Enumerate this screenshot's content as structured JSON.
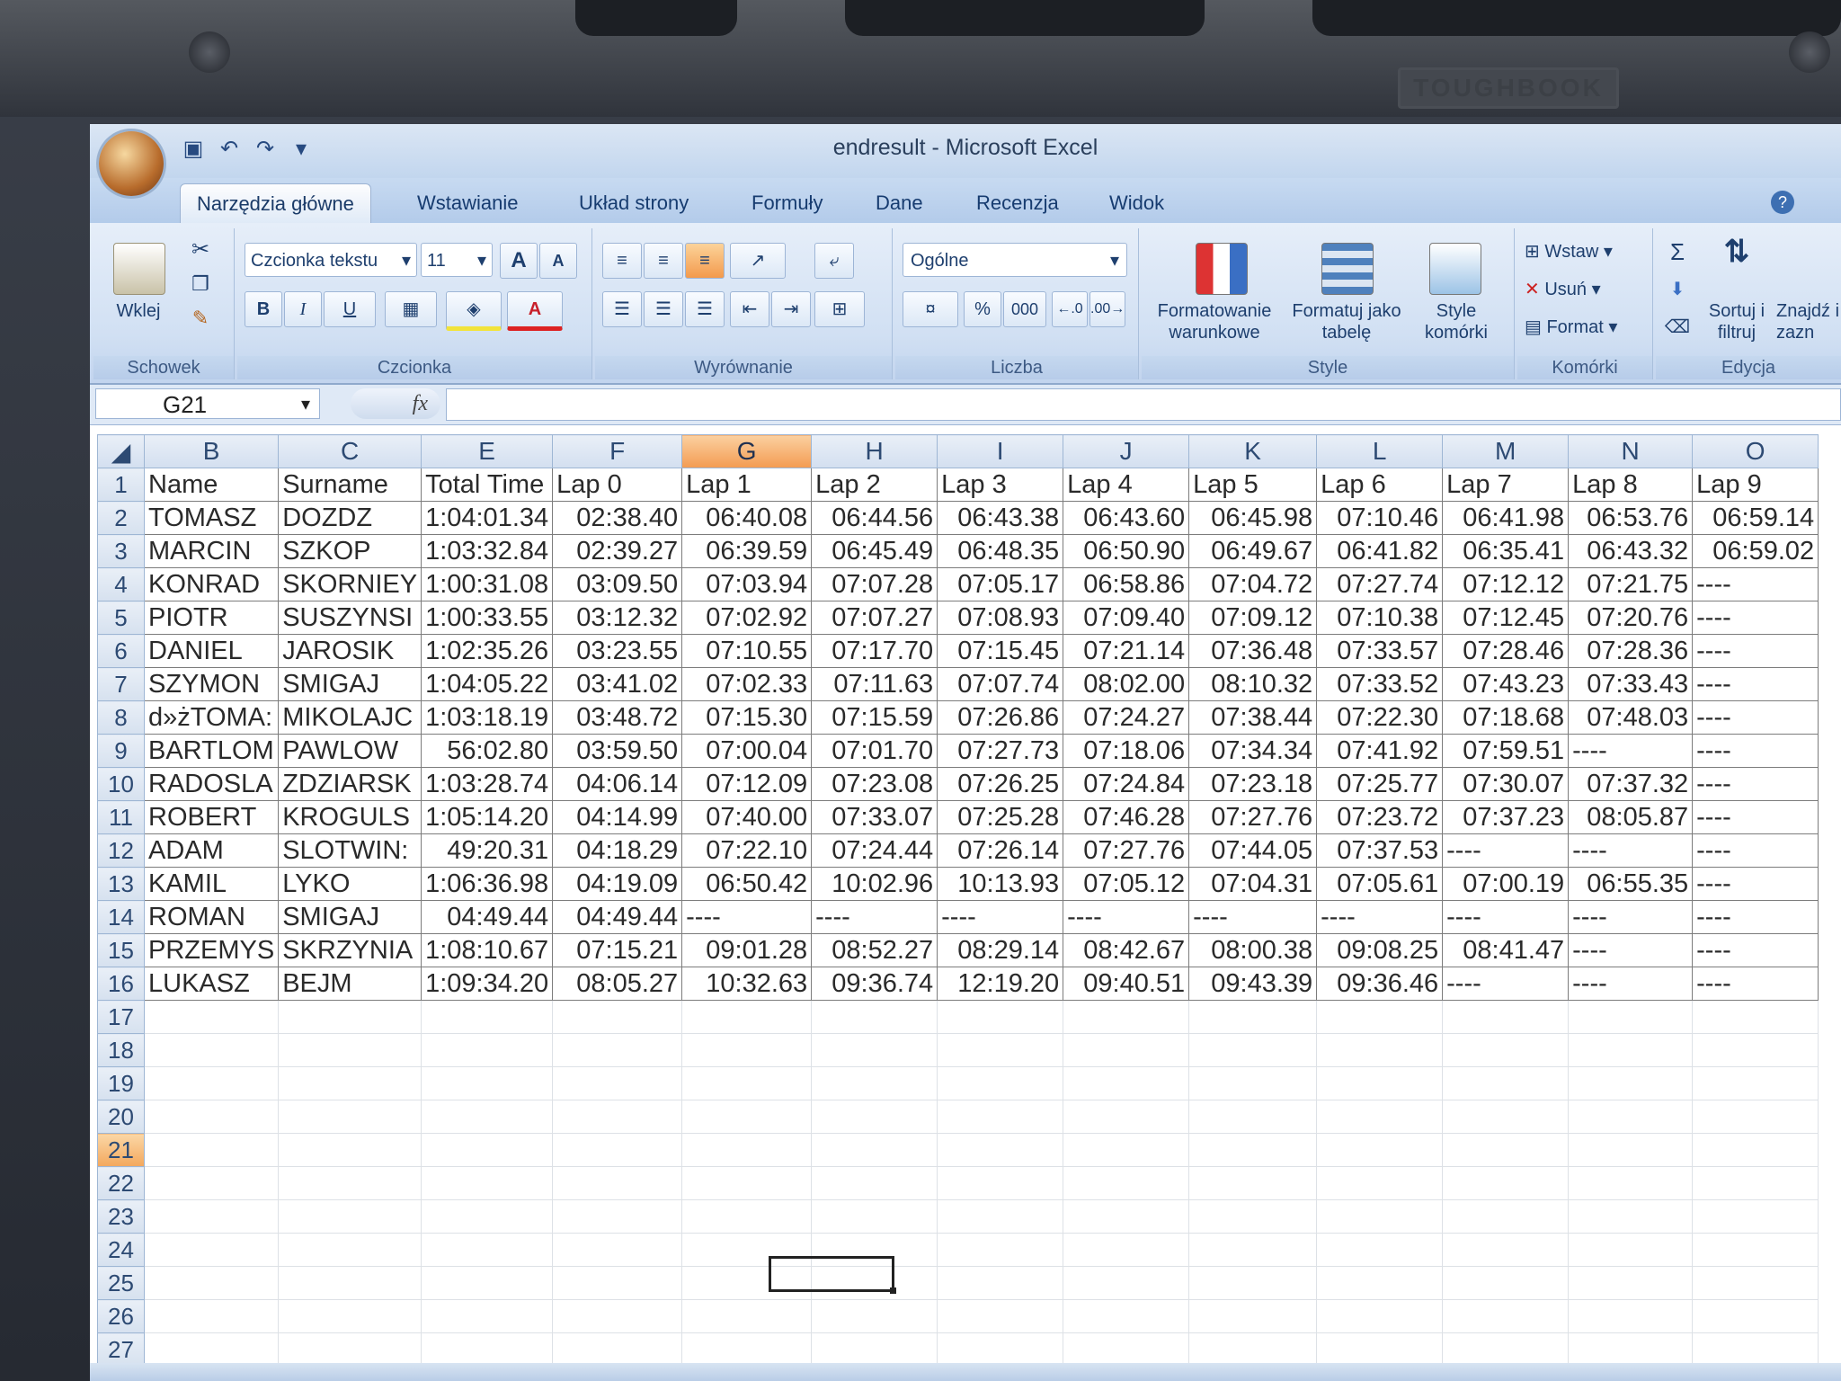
{
  "device": {
    "brand": "TOUGHBOOK"
  },
  "window": {
    "title": "endresult - Microsoft Excel"
  },
  "tabs": [
    "Narzędzia główne",
    "Wstawianie",
    "Układ strony",
    "Formuły",
    "Dane",
    "Recenzja",
    "Widok"
  ],
  "ribbon": {
    "clipboard": {
      "paste": "Wklej",
      "label": "Schowek"
    },
    "font": {
      "name": "Czcionka tekstu",
      "size": "11",
      "bold": "B",
      "italic": "I",
      "underline": "U",
      "label": "Czcionka"
    },
    "alignment": {
      "label": "Wyrównanie"
    },
    "number": {
      "format": "Ogólne",
      "percent": "%",
      "thousands": "000",
      "label": "Liczba"
    },
    "styles": {
      "conditional": "Formatowanie warunkowe",
      "as_table": "Formatuj jako tabelę",
      "cell_styles": "Style komórki",
      "label": "Style"
    },
    "cells": {
      "insert": "Wstaw",
      "delete": "Usuń",
      "format": "Format",
      "label": "Komórki"
    },
    "editing": {
      "sort": "Sortuj i filtruj",
      "find": "Znajdź i zazn",
      "label": "Edycja"
    }
  },
  "formula_bar": {
    "name_box": "G21",
    "fx": "fx",
    "value": ""
  },
  "columns": [
    "B",
    "C",
    "E",
    "F",
    "G",
    "H",
    "I",
    "J",
    "K",
    "L",
    "M",
    "N",
    "O"
  ],
  "selected_column": "G",
  "selected_row": "21",
  "rows": [
    {
      "n": "1",
      "cells": [
        "Name",
        "Surname",
        "Total Time",
        "Lap 0",
        "Lap 1",
        "Lap 2",
        "Lap 3",
        "Lap 4",
        "Lap 5",
        "Lap 6",
        "Lap 7",
        "Lap 8",
        "Lap 9"
      ]
    },
    {
      "n": "2",
      "cells": [
        "TOMASZ",
        "DOZDZ",
        "1:04:01.34",
        "02:38.40",
        "06:40.08",
        "06:44.56",
        "06:43.38",
        "06:43.60",
        "06:45.98",
        "07:10.46",
        "06:41.98",
        "06:53.76",
        "06:59.14"
      ]
    },
    {
      "n": "3",
      "cells": [
        "MARCIN",
        "SZKOP",
        "1:03:32.84",
        "02:39.27",
        "06:39.59",
        "06:45.49",
        "06:48.35",
        "06:50.90",
        "06:49.67",
        "06:41.82",
        "06:35.41",
        "06:43.32",
        "06:59.02"
      ]
    },
    {
      "n": "4",
      "cells": [
        "KONRAD",
        "SKORNIEY",
        "1:00:31.08",
        "03:09.50",
        "07:03.94",
        "07:07.28",
        "07:05.17",
        "06:58.86",
        "07:04.72",
        "07:27.74",
        "07:12.12",
        "07:21.75",
        "----"
      ]
    },
    {
      "n": "5",
      "cells": [
        "PIOTR",
        "SUSZYNSI",
        "1:00:33.55",
        "03:12.32",
        "07:02.92",
        "07:07.27",
        "07:08.93",
        "07:09.40",
        "07:09.12",
        "07:10.38",
        "07:12.45",
        "07:20.76",
        "----"
      ]
    },
    {
      "n": "6",
      "cells": [
        "DANIEL",
        "JAROSIK",
        "1:02:35.26",
        "03:23.55",
        "07:10.55",
        "07:17.70",
        "07:15.45",
        "07:21.14",
        "07:36.48",
        "07:33.57",
        "07:28.46",
        "07:28.36",
        "----"
      ]
    },
    {
      "n": "7",
      "cells": [
        "SZYMON",
        "SMIGAJ",
        "1:04:05.22",
        "03:41.02",
        "07:02.33",
        "07:11.63",
        "07:07.74",
        "08:02.00",
        "08:10.32",
        "07:33.52",
        "07:43.23",
        "07:33.43",
        "----"
      ]
    },
    {
      "n": "8",
      "cells": [
        "d»żTOMA:",
        "MIKOLAJC",
        "1:03:18.19",
        "03:48.72",
        "07:15.30",
        "07:15.59",
        "07:26.86",
        "07:24.27",
        "07:38.44",
        "07:22.30",
        "07:18.68",
        "07:48.03",
        "----"
      ]
    },
    {
      "n": "9",
      "cells": [
        "BARTLOM",
        "PAWLOW",
        "56:02.80",
        "03:59.50",
        "07:00.04",
        "07:01.70",
        "07:27.73",
        "07:18.06",
        "07:34.34",
        "07:41.92",
        "07:59.51",
        "----",
        "----"
      ]
    },
    {
      "n": "10",
      "cells": [
        "RADOSLA",
        "ZDZIARSK",
        "1:03:28.74",
        "04:06.14",
        "07:12.09",
        "07:23.08",
        "07:26.25",
        "07:24.84",
        "07:23.18",
        "07:25.77",
        "07:30.07",
        "07:37.32",
        "----"
      ]
    },
    {
      "n": "11",
      "cells": [
        "ROBERT",
        "KROGULS",
        "1:05:14.20",
        "04:14.99",
        "07:40.00",
        "07:33.07",
        "07:25.28",
        "07:46.28",
        "07:27.76",
        "07:23.72",
        "07:37.23",
        "08:05.87",
        "----"
      ]
    },
    {
      "n": "12",
      "cells": [
        "ADAM",
        "SLOTWIN:",
        "49:20.31",
        "04:18.29",
        "07:22.10",
        "07:24.44",
        "07:26.14",
        "07:27.76",
        "07:44.05",
        "07:37.53",
        "----",
        "----",
        "----"
      ]
    },
    {
      "n": "13",
      "cells": [
        "KAMIL",
        "LYKO",
        "1:06:36.98",
        "04:19.09",
        "06:50.42",
        "10:02.96",
        "10:13.93",
        "07:05.12",
        "07:04.31",
        "07:05.61",
        "07:00.19",
        "06:55.35",
        "----"
      ]
    },
    {
      "n": "14",
      "cells": [
        "ROMAN",
        "SMIGAJ",
        "04:49.44",
        "04:49.44",
        "----",
        "----",
        "----",
        "----",
        "----",
        "----",
        "----",
        "----",
        "----"
      ]
    },
    {
      "n": "15",
      "cells": [
        "PRZEMYS",
        "SKRZYNIA",
        "1:08:10.67",
        "07:15.21",
        "09:01.28",
        "08:52.27",
        "08:29.14",
        "08:42.67",
        "08:00.38",
        "09:08.25",
        "08:41.47",
        "----",
        "----"
      ]
    },
    {
      "n": "16",
      "cells": [
        "LUKASZ",
        "BEJM",
        "1:09:34.20",
        "08:05.27",
        "10:32.63",
        "09:36.74",
        "12:19.20",
        "09:40.51",
        "09:43.39",
        "09:36.46",
        "----",
        "----",
        "----"
      ]
    }
  ],
  "empty_rows": [
    "17",
    "18",
    "19",
    "20",
    "21",
    "22",
    "23",
    "24",
    "25",
    "26",
    "27"
  ]
}
